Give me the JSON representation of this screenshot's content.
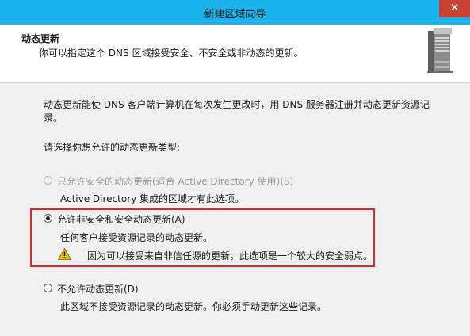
{
  "window": {
    "title": "新建区域向导",
    "close_glyph": "✕"
  },
  "header": {
    "title": "动态更新",
    "description": "你可以指定这个 DNS 区域接受安全、不安全或非动态的更新。",
    "icon": "server-icon"
  },
  "main": {
    "intro_line1": "动态更新能使 DNS 客户端计算机在每次发生更改时，用 DNS 服务器注册并动态更新资源记",
    "intro_line2": "录。",
    "prompt": "请选择你想允许的动态更新类型:",
    "options": [
      {
        "label": "只允许安全的动态更新(适合 Active Directory 使用)(S)",
        "description": "Active Directory 集成的区域才有此选项。",
        "checked": false,
        "disabled": true
      },
      {
        "label": "允许非安全和安全动态更新(A)",
        "description": "任何客户接受资源记录的动态更新。",
        "warning": "因为可以接受来自非信任源的更新，此选项是一个较大的安全弱点。",
        "checked": true,
        "disabled": false
      },
      {
        "label": "不允许动态更新(D)",
        "description": "此区域不接受资源记录的动态更新。你必须手动更新这些记录。",
        "checked": false,
        "disabled": false
      }
    ]
  },
  "colors": {
    "titlebar": "#19b2ed",
    "close_button": "#c94236",
    "highlight_border": "#e02727",
    "warning_fill": "#f5c400"
  }
}
